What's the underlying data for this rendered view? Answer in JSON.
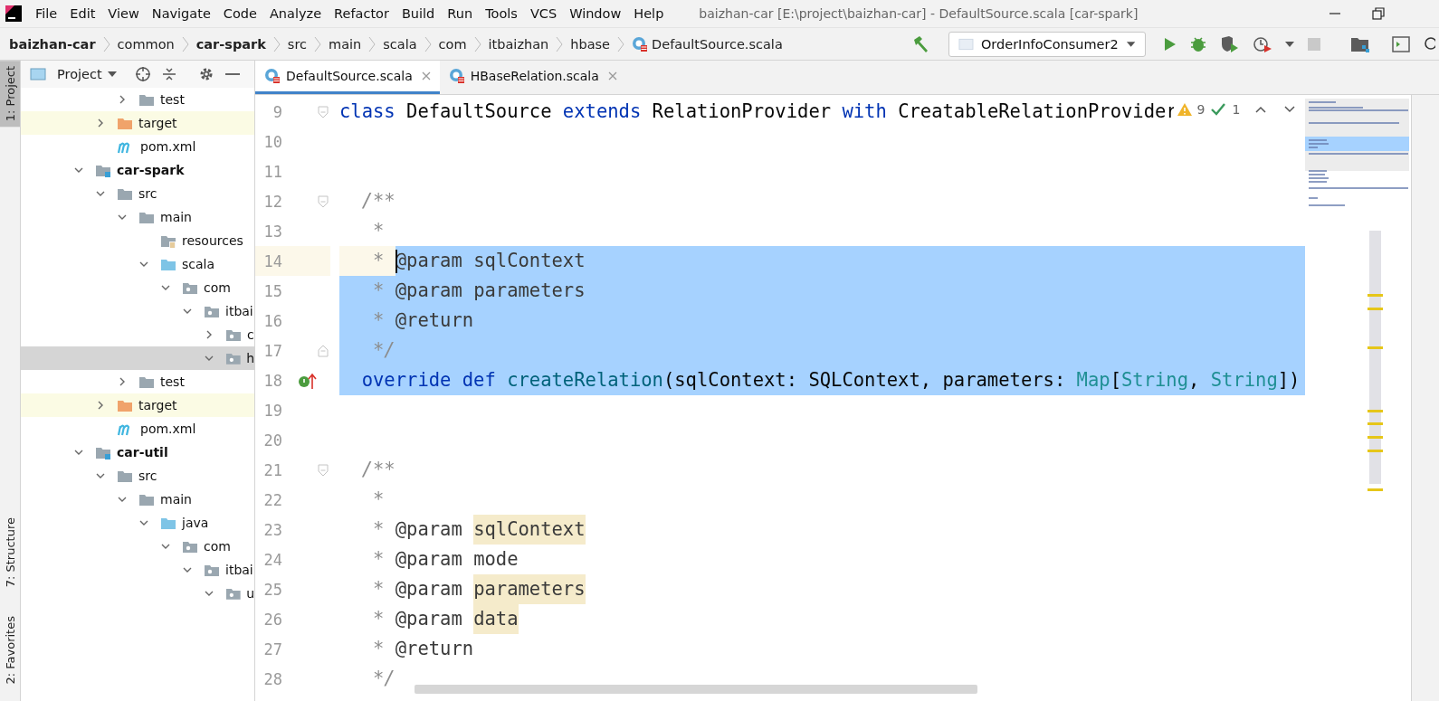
{
  "window": {
    "title": "baizhan-car [E:\\project\\baizhan-car] - DefaultSource.scala [car-spark]"
  },
  "menu": [
    "File",
    "Edit",
    "View",
    "Navigate",
    "Code",
    "Analyze",
    "Refactor",
    "Build",
    "Run",
    "Tools",
    "VCS",
    "Window",
    "Help"
  ],
  "breadcrumbs": [
    {
      "label": "baizhan-car",
      "kind": "module"
    },
    {
      "label": "common",
      "kind": "folder"
    },
    {
      "label": "car-spark",
      "kind": "module"
    },
    {
      "label": "src",
      "kind": "folder"
    },
    {
      "label": "main",
      "kind": "folder"
    },
    {
      "label": "scala",
      "kind": "folder"
    },
    {
      "label": "com",
      "kind": "folder"
    },
    {
      "label": "itbaizhan",
      "kind": "folder"
    },
    {
      "label": "hbase",
      "kind": "folder"
    },
    {
      "label": "DefaultSource.scala",
      "kind": "file"
    }
  ],
  "run_config": {
    "label": "OrderInfoConsumer2"
  },
  "tool_windows": [
    {
      "label": "1: Project",
      "selected": true
    },
    {
      "label": "7: Structure",
      "selected": false
    },
    {
      "label": "2: Favorites",
      "selected": false
    }
  ],
  "project_panel": {
    "title": "Project"
  },
  "tree": [
    {
      "children": [
        {
          "children": [
            {
              "label": "test",
              "kind": "folder",
              "expanded": false,
              "selected": false
            }
          ]
        },
        {
          "label": "target",
          "kind": "excluded",
          "expanded": false,
          "selected": false
        },
        {
          "label": "pom.xml",
          "kind": "maven",
          "selected": false
        }
      ]
    },
    {
      "label": "car-spark",
      "kind": "module",
      "expanded": true,
      "selected": false,
      "children": [
        {
          "label": "src",
          "kind": "folder",
          "expanded": true,
          "selected": false,
          "children": [
            {
              "label": "main",
              "kind": "folder",
              "expanded": true,
              "selected": false,
              "children": [
                {
                  "label": "resources",
                  "kind": "resources",
                  "selected": false
                },
                {
                  "label": "scala",
                  "kind": "source",
                  "expanded": true,
                  "selected": false,
                  "children": [
                    {
                      "label": "com",
                      "kind": "package",
                      "expanded": true,
                      "selected": false,
                      "children": [
                        {
                          "label": "itbai",
                          "kind": "package",
                          "expanded": true,
                          "selected": false,
                          "children": [
                            {
                              "label": "c",
                              "kind": "package",
                              "expanded": false,
                              "selected": false
                            },
                            {
                              "label": "h",
                              "kind": "package",
                              "expanded": true,
                              "selected": true
                            }
                          ]
                        }
                      ]
                    }
                  ]
                }
              ]
            },
            {
              "label": "test",
              "kind": "folder",
              "expanded": false,
              "selected": false
            }
          ]
        },
        {
          "label": "target",
          "kind": "excluded",
          "expanded": false,
          "selected": false
        },
        {
          "label": "pom.xml",
          "kind": "maven",
          "selected": false
        }
      ]
    },
    {
      "label": "car-util",
      "kind": "module",
      "expanded": true,
      "selected": false,
      "children": [
        {
          "label": "src",
          "kind": "folder",
          "expanded": true,
          "selected": false,
          "children": [
            {
              "label": "main",
              "kind": "folder",
              "expanded": true,
              "selected": false,
              "children": [
                {
                  "label": "java",
                  "kind": "source",
                  "expanded": true,
                  "selected": false,
                  "children": [
                    {
                      "label": "com",
                      "kind": "package",
                      "expanded": true,
                      "selected": false,
                      "children": [
                        {
                          "label": "itbai",
                          "kind": "package",
                          "expanded": true,
                          "selected": false,
                          "children": [
                            {
                              "label": "u",
                              "kind": "package",
                              "expanded": true,
                              "selected": false
                            }
                          ]
                        }
                      ]
                    }
                  ]
                }
              ]
            }
          ]
        }
      ]
    }
  ],
  "tabs": [
    {
      "label": "DefaultSource.scala",
      "selected": true
    },
    {
      "label": "HBaseRelation.scala",
      "selected": false
    }
  ],
  "inspections": {
    "warnings": "9",
    "weak_warnings": "1"
  },
  "code": [
    {
      "number": "9",
      "selected": false,
      "gutter": {
        "kind": "fold-start"
      },
      "tokens": [
        {
          "kind": "keyword",
          "text": "class"
        },
        {
          "kind": "plain",
          "text": " DefaultSource "
        },
        {
          "kind": "keyword",
          "text": "extends"
        },
        {
          "kind": "plain",
          "text": " RelationProvider "
        },
        {
          "kind": "keyword",
          "text": "with"
        },
        {
          "kind": "plain",
          "text": " CreatableRelationProvider"
        }
      ]
    },
    {
      "number": "10",
      "selected": false
    },
    {
      "number": "11",
      "selected": false
    },
    {
      "number": "12",
      "selected": false,
      "gutter": {
        "kind": "fold-start"
      },
      "tokens": [
        {
          "kind": "comment",
          "text": "  /**"
        }
      ]
    },
    {
      "number": "13",
      "selected": false,
      "tokens": [
        {
          "kind": "comment",
          "text": "   *"
        }
      ]
    },
    {
      "number": "14",
      "selected": true,
      "tokens": [
        {
          "kind": "comment",
          "text": "   * "
        },
        {
          "kind": "doctag",
          "text": "@param ",
          "caret": true
        },
        {
          "kind": "docparam",
          "text": "sqlContext"
        }
      ]
    },
    {
      "number": "15",
      "selected": true,
      "tokens": [
        {
          "kind": "comment",
          "text": "   * "
        },
        {
          "kind": "doctag",
          "text": "@param "
        },
        {
          "kind": "docparam",
          "text": "parameters"
        }
      ]
    },
    {
      "number": "16",
      "selected": true,
      "tokens": [
        {
          "kind": "comment",
          "text": "   * "
        },
        {
          "kind": "doctag",
          "text": "@return"
        }
      ]
    },
    {
      "number": "17",
      "selected": true,
      "gutter": {
        "kind": "fold-end"
      },
      "tokens": [
        {
          "kind": "comment",
          "text": "   */"
        }
      ]
    },
    {
      "number": "18",
      "selected": true,
      "gutter": {
        "kind": "implements"
      },
      "tokens": [
        {
          "kind": "keyword",
          "text": "  override def "
        },
        {
          "kind": "method",
          "text": "createRelation"
        },
        {
          "kind": "plain",
          "text": "(sqlContext: SQLContext, parameters: "
        },
        {
          "kind": "type",
          "text": "Map"
        },
        {
          "kind": "plain",
          "text": "["
        },
        {
          "kind": "type",
          "text": "String"
        },
        {
          "kind": "plain",
          "text": ", "
        },
        {
          "kind": "type",
          "text": "String"
        },
        {
          "kind": "plain",
          "text": "])"
        }
      ]
    },
    {
      "number": "19",
      "selected": false
    },
    {
      "number": "20",
      "selected": false
    },
    {
      "number": "21",
      "selected": false,
      "gutter": {
        "kind": "fold-start"
      },
      "tokens": [
        {
          "kind": "comment",
          "text": "  /**"
        }
      ]
    },
    {
      "number": "22",
      "selected": false,
      "tokens": [
        {
          "kind": "comment",
          "text": "   *"
        }
      ]
    },
    {
      "number": "23",
      "selected": false,
      "tokens": [
        {
          "kind": "comment",
          "text": "   * "
        },
        {
          "kind": "doctag",
          "text": "@param "
        },
        {
          "kind": "docparam",
          "text": "sqlContext",
          "highlighted": true
        }
      ]
    },
    {
      "number": "24",
      "selected": false,
      "tokens": [
        {
          "kind": "comment",
          "text": "   * "
        },
        {
          "kind": "doctag",
          "text": "@param "
        },
        {
          "kind": "docparam",
          "text": "mode",
          "highlighted": false
        }
      ]
    },
    {
      "number": "25",
      "selected": false,
      "tokens": [
        {
          "kind": "comment",
          "text": "   * "
        },
        {
          "kind": "doctag",
          "text": "@param "
        },
        {
          "kind": "docparam",
          "text": "parameters",
          "highlighted": true
        }
      ]
    },
    {
      "number": "26",
      "selected": false,
      "tokens": [
        {
          "kind": "comment",
          "text": "   * "
        },
        {
          "kind": "doctag",
          "text": "@param "
        },
        {
          "kind": "docparam",
          "text": "data",
          "highlighted": true
        }
      ]
    },
    {
      "number": "27",
      "selected": false,
      "tokens": [
        {
          "kind": "comment",
          "text": "   * "
        },
        {
          "kind": "doctag",
          "text": "@return"
        }
      ]
    },
    {
      "number": "28",
      "selected": false,
      "tokens": [
        {
          "kind": "comment",
          "text": "   */"
        }
      ]
    }
  ]
}
